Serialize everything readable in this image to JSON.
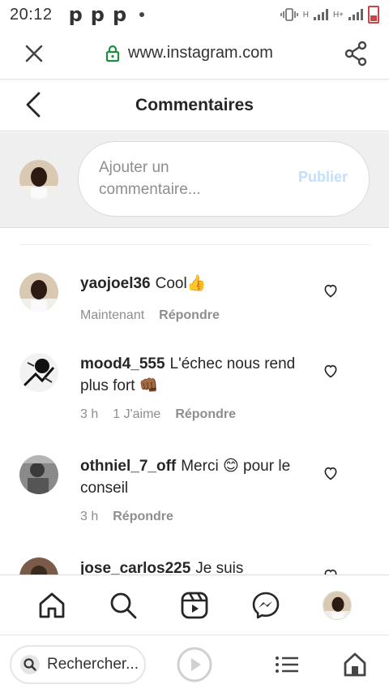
{
  "status_bar": {
    "time": "20:12",
    "app_icons": [
      "p",
      "p",
      "p"
    ]
  },
  "browser": {
    "url": "www.instagram.com",
    "search_label": "Rechercher..."
  },
  "header": {
    "title": "Commentaires"
  },
  "composer": {
    "placeholder": "Ajouter un commentaire...",
    "publish_label": "Publier"
  },
  "comments": [
    {
      "username": "yaojoel36",
      "text": "Cool👍",
      "time": "Maintenant",
      "likes": "",
      "reply_label": "Répondre"
    },
    {
      "username": "mood4_555",
      "text": "L'échec nous rend plus fort 👊🏾",
      "time": "3 h",
      "likes": "1 J'aime",
      "reply_label": "Répondre"
    },
    {
      "username": "othniel_7_off",
      "text": "Merci 😊 pour le conseil",
      "time": "3 h",
      "likes": "",
      "reply_label": "Répondre"
    },
    {
      "username": "jose_carlos225",
      "text": "Je suis",
      "time": "",
      "likes": "",
      "reply_label": ""
    }
  ],
  "colors": {
    "accent_disabled": "#c0dffd",
    "battery": "#cc4444",
    "text": "#262626",
    "muted": "#8e8e8e"
  }
}
